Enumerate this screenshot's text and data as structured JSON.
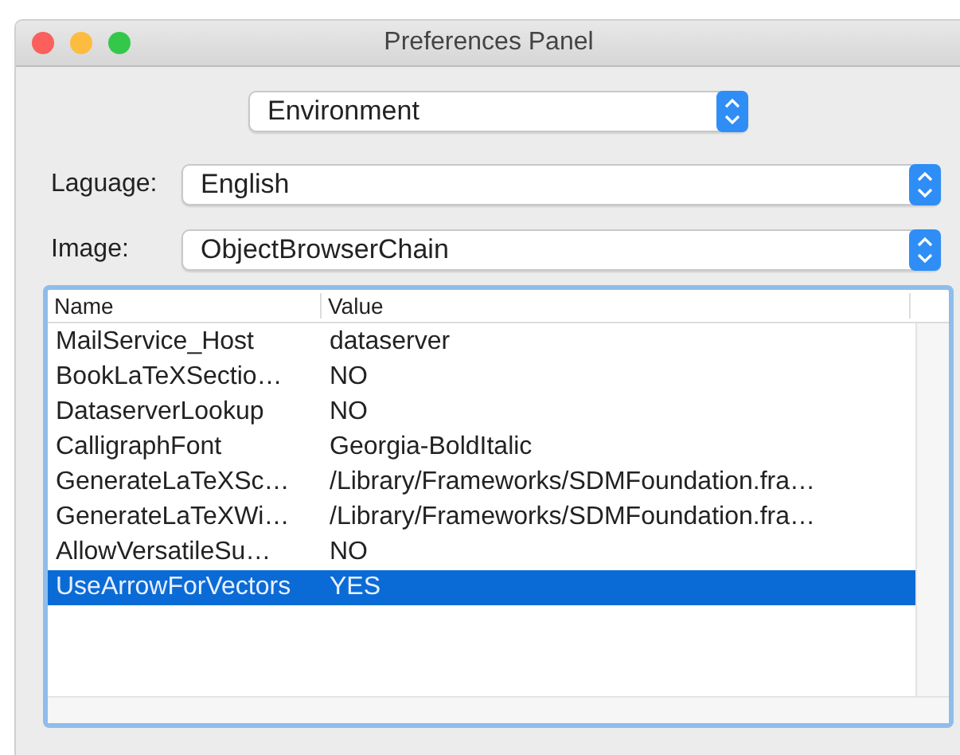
{
  "window": {
    "title": "Preferences Panel"
  },
  "category_popup": {
    "value": "Environment"
  },
  "fields": [
    {
      "label": "Laguage:",
      "value": "English"
    },
    {
      "label": "Image:",
      "value": "ObjectBrowserChain"
    }
  ],
  "table": {
    "columns": [
      "Name",
      "Value"
    ],
    "rows": [
      {
        "name": "MailService_Host",
        "value": "dataserver",
        "selected": false
      },
      {
        "name": "BookLaTeXSectio…",
        "value": "NO",
        "selected": false
      },
      {
        "name": "DataserverLookup",
        "value": "NO",
        "selected": false
      },
      {
        "name": "CalligraphFont",
        "value": "Georgia-BoldItalic",
        "selected": false
      },
      {
        "name": "GenerateLaTeXSc…",
        "value": "/Library/Frameworks/SDMFoundation.fra…",
        "selected": false
      },
      {
        "name": "GenerateLaTeXWi…",
        "value": "/Library/Frameworks/SDMFoundation.fra…",
        "selected": false
      },
      {
        "name": "AllowVersatileSu…",
        "value": "NO",
        "selected": false
      },
      {
        "name": "UseArrowForVectors",
        "value": "YES",
        "selected": true
      }
    ]
  }
}
